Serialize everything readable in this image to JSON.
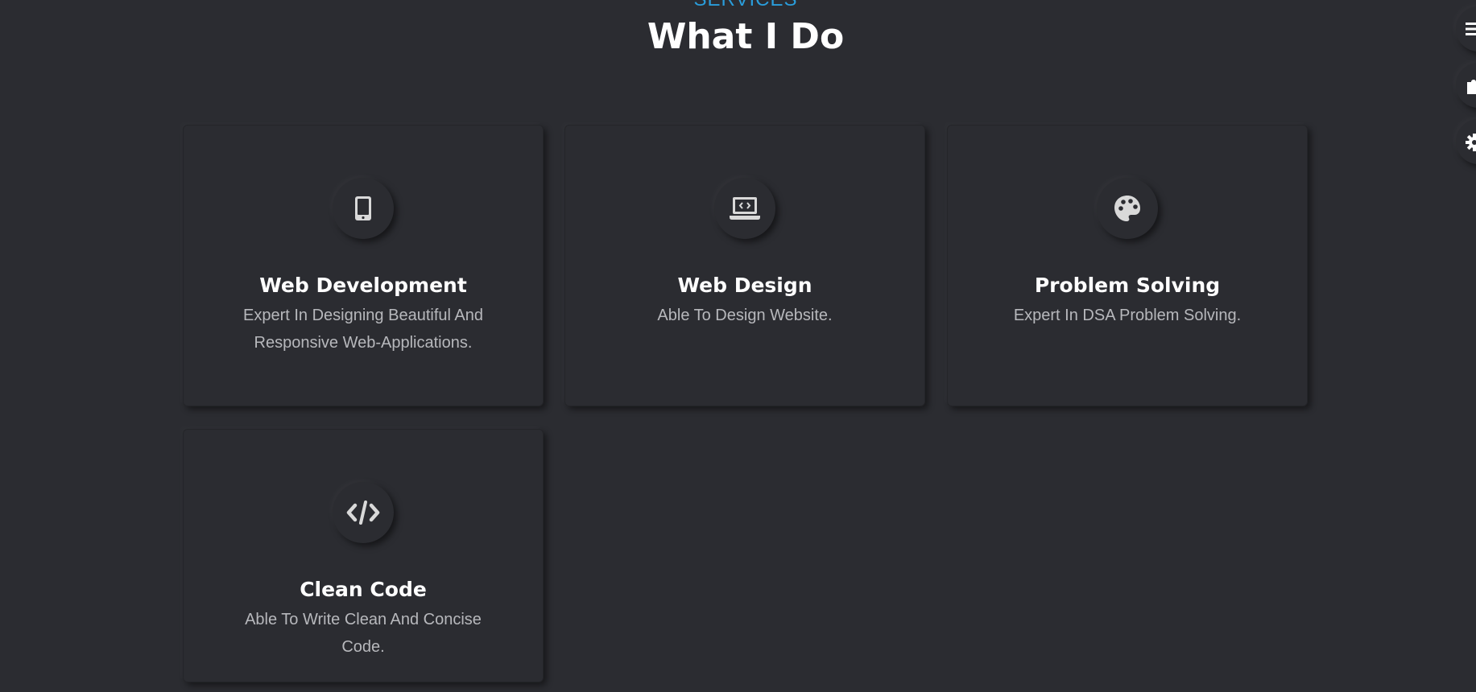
{
  "section": {
    "eyebrow": "SERVICES",
    "title": "What I Do"
  },
  "cards": [
    {
      "icon": "mobile-phone-icon",
      "title": "Web Development",
      "description": "Expert In Designing Beautiful And Responsive Web-Applications."
    },
    {
      "icon": "laptop-code-icon",
      "title": "Web Design",
      "description": "Able To Design Website."
    },
    {
      "icon": "palette-icon",
      "title": "Problem Solving",
      "description": "Expert In DSA Problem Solving."
    },
    {
      "icon": "code-icon",
      "title": "Clean Code",
      "description": "Able To Write Clean And Concise Code."
    }
  ],
  "side_buttons": [
    {
      "icon": "menu-icon"
    },
    {
      "icon": "puzzle-icon"
    },
    {
      "icon": "gear-icon"
    }
  ],
  "colors": {
    "background": "#2b2c31",
    "accent": "#2a9ddb",
    "title": "#ffffff",
    "text": "#b7b8bc",
    "icon": "#d9d9d9"
  }
}
